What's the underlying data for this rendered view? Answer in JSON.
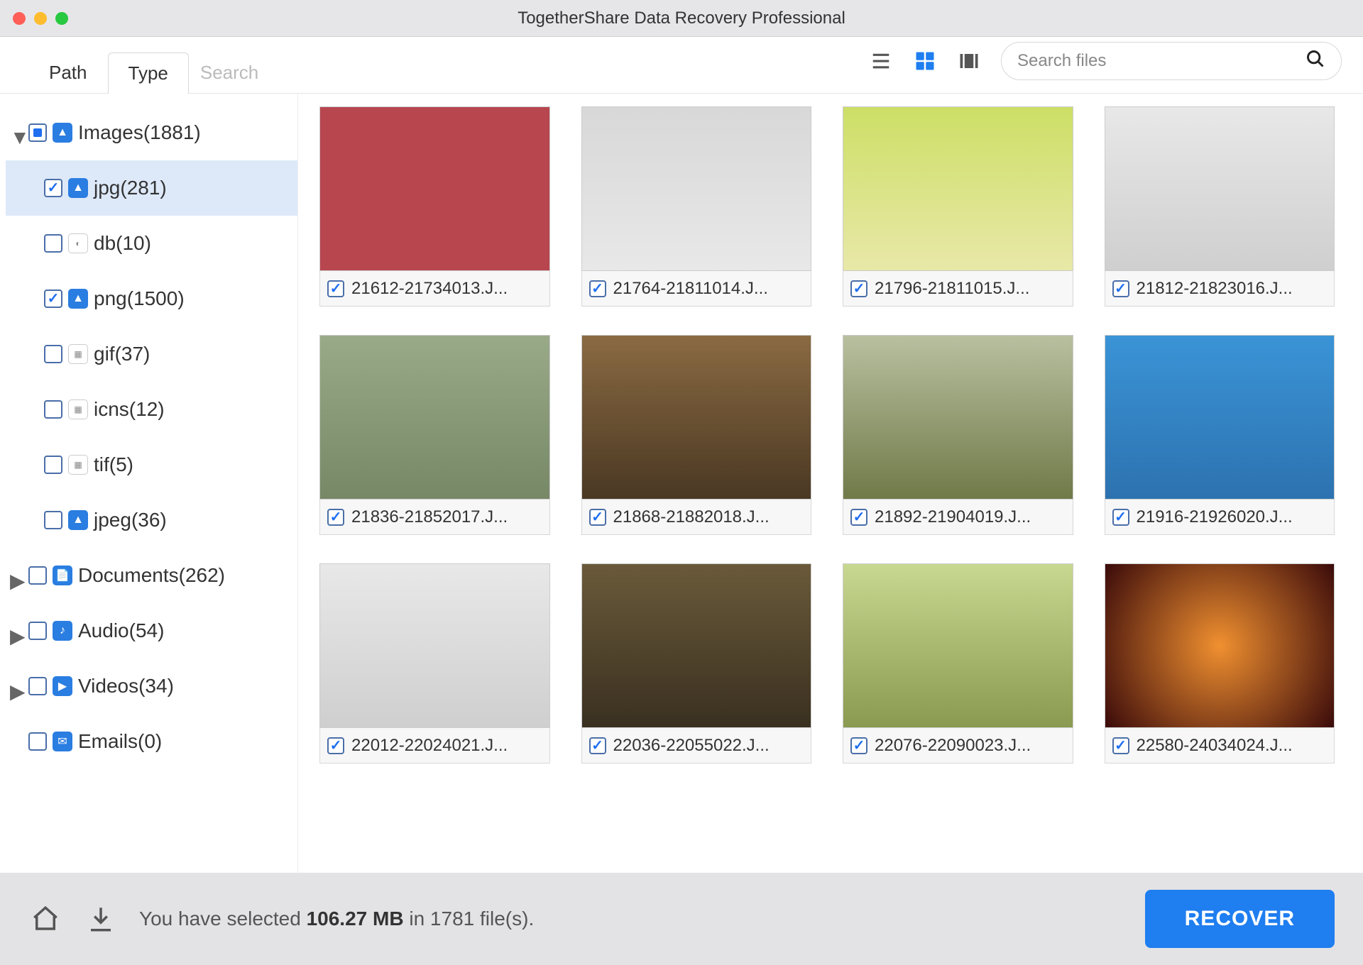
{
  "window": {
    "title": "TogetherShare Data Recovery Professional"
  },
  "tabs": {
    "path": "Path",
    "type": "Type",
    "search_placeholder": "Search"
  },
  "search": {
    "placeholder": "Search files"
  },
  "sidebar": {
    "images": {
      "label": "Images(1881)"
    },
    "jpg": {
      "label": "jpg(281)"
    },
    "db": {
      "label": "db(10)"
    },
    "png": {
      "label": "png(1500)"
    },
    "gif": {
      "label": "gif(37)"
    },
    "icns": {
      "label": "icns(12)"
    },
    "tif": {
      "label": "tif(5)"
    },
    "jpeg": {
      "label": "jpeg(36)"
    },
    "documents": {
      "label": "Documents(262)"
    },
    "audio": {
      "label": "Audio(54)"
    },
    "videos": {
      "label": "Videos(34)"
    },
    "emails": {
      "label": "Emails(0)"
    }
  },
  "files": [
    {
      "name": "21612-21734013.J..."
    },
    {
      "name": "21764-21811014.J..."
    },
    {
      "name": "21796-21811015.J..."
    },
    {
      "name": "21812-21823016.J..."
    },
    {
      "name": "21836-21852017.J..."
    },
    {
      "name": "21868-21882018.J..."
    },
    {
      "name": "21892-21904019.J..."
    },
    {
      "name": "21916-21926020.J..."
    },
    {
      "name": "22012-22024021.J..."
    },
    {
      "name": "22036-22055022.J..."
    },
    {
      "name": "22076-22090023.J..."
    },
    {
      "name": "22580-24034024.J..."
    }
  ],
  "footer": {
    "prefix": "You have selected ",
    "size": "106.27 MB",
    "mid": " in ",
    "count": "1781",
    "suffix": " file(s).",
    "recover": "RECOVER"
  }
}
